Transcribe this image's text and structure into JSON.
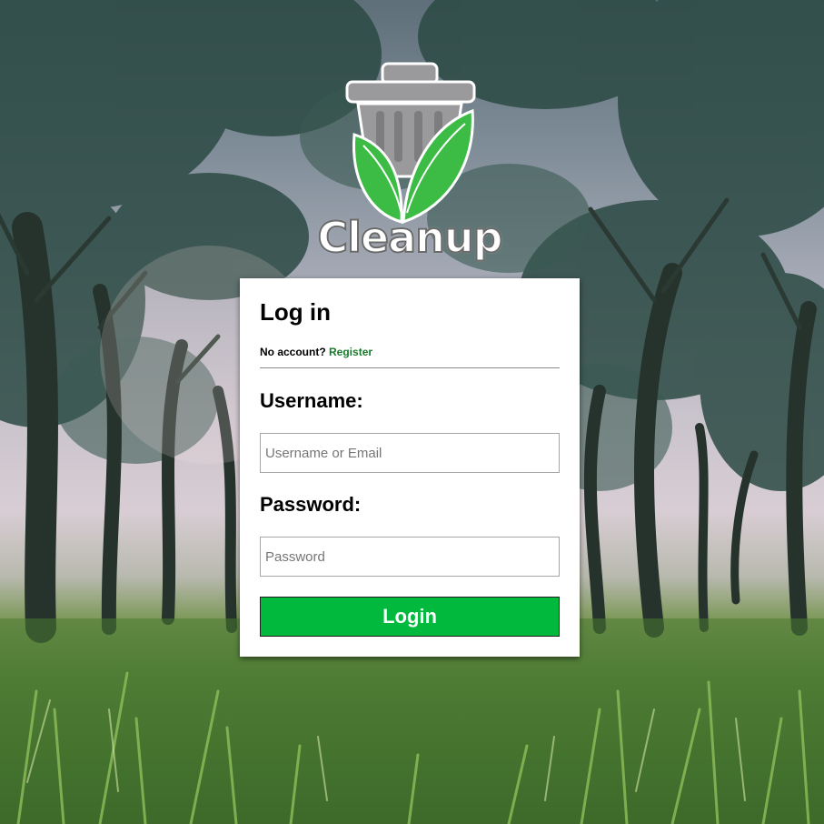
{
  "app": {
    "logo_text": "Cleanup"
  },
  "login": {
    "title": "Log in",
    "no_account_text": "No account?",
    "register_link": "Register",
    "username_label": "Username:",
    "username_placeholder": "Username or Email",
    "username_value": "",
    "password_label": "Password:",
    "password_placeholder": "Password",
    "password_value": "",
    "submit_label": "Login"
  },
  "colors": {
    "accent": "#00b93d",
    "link": "#1a7a2c",
    "leaf": "#3cbc45",
    "bin": "#9a9a9c"
  },
  "icons": {
    "logo": "trash-bin-leaf-icon"
  }
}
